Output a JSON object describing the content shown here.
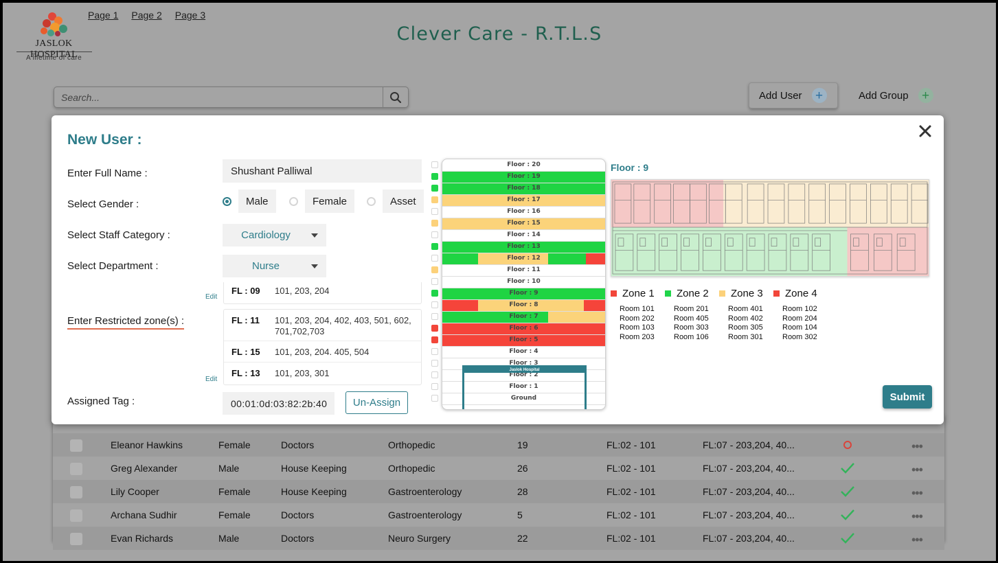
{
  "brand": {
    "name": "JASLOK HOSPITAL",
    "tagline": "A lifetime of care"
  },
  "nav": [
    "Page 1",
    "Page 2",
    "Page 3"
  ],
  "app_title": "Clever Care - R.T.L.S",
  "search": {
    "placeholder": "Search..."
  },
  "actions": {
    "add_user": "Add User",
    "add_group": "Add Group"
  },
  "modal": {
    "title": "New User :",
    "labels": {
      "full_name": "Enter Full Name :",
      "gender": "Select Gender :",
      "staff_category": "Select Staff Category :",
      "department": "Select Department :",
      "restricted": "Enter Restricted zone(s) :",
      "tag": "Assigned Tag :"
    },
    "full_name_value": "Shushant Palliwal",
    "gender_options": [
      "Male",
      "Female",
      "Asset"
    ],
    "gender_selected": "Male",
    "staff_category_value": "Cardiology",
    "department_value": "Nurse",
    "edit_label": "Edit",
    "zones_first": {
      "floor": "FL : 09",
      "rooms": "101, 203, 204"
    },
    "zones_list": [
      {
        "floor": "FL : 11",
        "rooms": "101, 203, 204, 402, 403, 501, 602, 701,702,703"
      },
      {
        "floor": "FL : 15",
        "rooms": "101, 203, 204. 405, 504"
      },
      {
        "floor": "FL : 13",
        "rooms": "101, 203, 301"
      }
    ],
    "tag_value": "00:01:0d:03:82:2b:40",
    "unassign_label": "Un-Assign",
    "submit_label": "Submit"
  },
  "building": {
    "name": "Jaslok Hospital",
    "floors": [
      {
        "label": "Floor : 20",
        "check": "none",
        "fill": []
      },
      {
        "label": "Floor : 19",
        "check": "#20d44a",
        "fill": [
          [
            "green",
            1
          ]
        ]
      },
      {
        "label": "Floor : 18",
        "check": "#20d44a",
        "fill": [
          [
            "green",
            1
          ]
        ]
      },
      {
        "label": "Floor : 17",
        "check": "#fcd17a",
        "fill": [
          [
            "yellow",
            1
          ]
        ]
      },
      {
        "label": "Floor : 16",
        "check": "none",
        "fill": []
      },
      {
        "label": "Floor : 15",
        "check": "#fcd17a",
        "fill": [
          [
            "yellow",
            1
          ]
        ]
      },
      {
        "label": "Floor : 14",
        "check": "none",
        "fill": []
      },
      {
        "label": "Floor : 13",
        "check": "#20d44a",
        "fill": [
          [
            "green",
            1
          ]
        ]
      },
      {
        "label": "Floor : 12",
        "check": "none",
        "fill": [
          [
            "green",
            0.22
          ],
          [
            "yellow",
            0.43
          ],
          [
            "green",
            0.23
          ],
          [
            "red",
            0.12
          ]
        ]
      },
      {
        "label": "Floor : 11",
        "check": "#fcd17a",
        "fill": []
      },
      {
        "label": "Floor : 10",
        "check": "none",
        "fill": []
      },
      {
        "label": "Floor : 9",
        "check": "#20d44a",
        "fill": [
          [
            "green",
            1
          ]
        ]
      },
      {
        "label": "Floor : 8",
        "check": "none",
        "fill": [
          [
            "red",
            0.22
          ],
          [
            "yellow",
            0.65
          ],
          [
            "red",
            0.13
          ]
        ]
      },
      {
        "label": "Floor : 7",
        "check": "none",
        "fill": [
          [
            "green",
            0.65
          ],
          [
            "yellow",
            0.35
          ]
        ]
      },
      {
        "label": "Floor : 6",
        "check": "#f2463a",
        "fill": [
          [
            "red",
            1
          ]
        ]
      },
      {
        "label": "Floor : 5",
        "check": "#f2463a",
        "fill": [
          [
            "red",
            1
          ]
        ]
      },
      {
        "label": "Floor : 4",
        "check": "none",
        "fill": []
      },
      {
        "label": "Floor : 3",
        "check": "none",
        "fill": []
      },
      {
        "label": "Floor : 2",
        "check": "none",
        "fill": []
      },
      {
        "label": "Floor : 1",
        "check": "none",
        "fill": []
      },
      {
        "label": "Ground",
        "check": "none",
        "fill": []
      }
    ]
  },
  "colors": {
    "green": "#1fd443",
    "yellow": "#fbd37a",
    "red": "#f5443a",
    "accent": "#2e7d8a"
  },
  "floor_plan": {
    "title": "Floor : 9"
  },
  "zones": [
    {
      "name": "Zone 1",
      "color": "#f2463a",
      "rooms": [
        "Room 101",
        "Room 202",
        "Room 103",
        "Room 203"
      ]
    },
    {
      "name": "Zone 2",
      "color": "#20d44a",
      "rooms": [
        "Room 201",
        "Room 405",
        "Room 303",
        "Room 106"
      ]
    },
    {
      "name": "Zone 3",
      "color": "#fcd17a",
      "rooms": [
        "Room 401",
        "Room 402",
        "Room 305",
        "Room 301"
      ]
    },
    {
      "name": "Zone 4",
      "color": "#f2463a",
      "rooms": [
        "Room 102",
        "Room 204",
        "Room 104",
        "Room 302"
      ]
    }
  ],
  "table_rows": [
    {
      "name": "Eleanor Hawkins",
      "gender": "Female",
      "category": "Doctors",
      "dept": "Orthopedic",
      "num": "19",
      "loc": "FL:02 - 101",
      "zones": "FL:07 - 203,204, 40...",
      "status": "circle"
    },
    {
      "name": "Greg Alexander",
      "gender": "Male",
      "category": "House Keeping",
      "dept": "Orthopedic",
      "num": "26",
      "loc": "FL:02 - 101",
      "zones": "FL:07 - 203,204, 40...",
      "status": "check"
    },
    {
      "name": "Lily Cooper",
      "gender": "Female",
      "category": "House Keeping",
      "dept": "Gastroenterology",
      "num": "28",
      "loc": "FL:02 - 101",
      "zones": "FL:07 - 203,204, 40...",
      "status": "check"
    },
    {
      "name": "Archana Sudhir",
      "gender": "Female",
      "category": "Doctors",
      "dept": "Gastroenterology",
      "num": "5",
      "loc": "FL:02 - 101",
      "zones": "FL:07 - 203,204, 40...",
      "status": "check"
    },
    {
      "name": "Evan Richards",
      "gender": "Male",
      "category": "Doctors",
      "dept": "Neuro Surgery",
      "num": "22",
      "loc": "FL:02 - 101",
      "zones": "FL:07 - 203,204, 40...",
      "status": "check"
    }
  ]
}
